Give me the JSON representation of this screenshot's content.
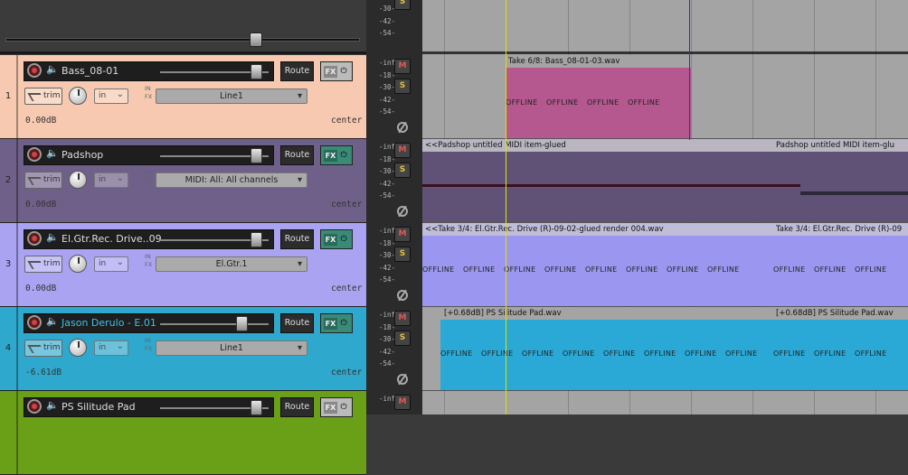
{
  "meter_scale": [
    "-inf",
    "-18-",
    "-30-",
    "-42-",
    "-54-"
  ],
  "master_scale": [
    "-30-",
    "-42-",
    "-54-"
  ],
  "buttons": {
    "mute": "M",
    "solo": "S",
    "route": "Route",
    "fx": "FX",
    "trim": "trim",
    "in": "in",
    "infx_top": "IN",
    "infx_bottom": "FX"
  },
  "tracks": [
    {
      "num": "1",
      "name": "Bass_08-01",
      "color": "#f7c9b0",
      "input": "Line1",
      "volume": "0.00dB",
      "pan": "center",
      "fx_active": false,
      "fader_level": 0.88
    },
    {
      "num": "2",
      "name": "Padshop",
      "color": "#6f6089",
      "input": "MIDI: All: All channels",
      "volume": "0.00dB",
      "pan": "center",
      "fx_active": true,
      "fader_level": 0.88
    },
    {
      "num": "3",
      "name": "El.Gtr.Rec. Drive..09",
      "color": "#a9a3f2",
      "input": "El.Gtr.1",
      "volume": "0.00dB",
      "pan": "center",
      "fx_active": true,
      "fader_level": 0.88
    },
    {
      "num": "4",
      "name": "Jason Derulo - E.01",
      "color": "#2ea8cc",
      "input": "Line1",
      "volume": "-6.61dB",
      "pan": "center",
      "fx_active": true,
      "fader_level": 0.75
    },
    {
      "num": "",
      "name": "PS Silitude Pad",
      "color": "#6aa018",
      "input": "",
      "volume": "",
      "pan": "",
      "fx_active": false,
      "fader_level": 0.88
    }
  ],
  "items": {
    "bass_take": "Take 6/8: Bass_08-01-03.wav",
    "padshop_left": "<<Padshop untitled MIDI item-glued",
    "padshop_right": "Padshop untitled MIDI item-glu",
    "gtr_left": "<<Take 3/4: El.Gtr.Rec. Drive (R)-09-02-glued render 004.wav",
    "gtr_right": "Take 3/4: El.Gtr.Rec. Drive (R)-09",
    "pad_left": "[+0.68dB] PS Silitude Pad.wav",
    "pad_right": "[+0.68dB] PS Silitude Pad.wav",
    "offline": "OFFLINE"
  },
  "colors": {
    "bass_item": "#b4588f",
    "padshop_item": "#5f5276",
    "gtr_item": "#9b97f0",
    "pad_item": "#2aa9d6",
    "edit_cursor": "#e0e000",
    "play_cursor": "#3030c0"
  }
}
